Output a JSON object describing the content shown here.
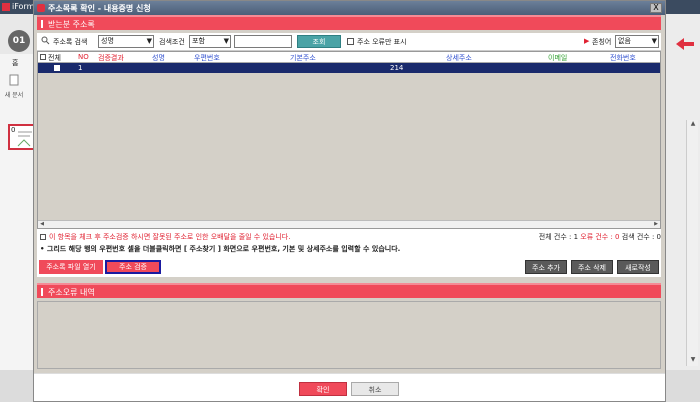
{
  "background": {
    "app_title": "iForm",
    "step_number": "01",
    "left_tab": "홈",
    "left_icon_label": "새 문서",
    "thumb_label": "0"
  },
  "dialog": {
    "title": "주소목록 확인 - 내용증명 신청",
    "close_label": "X"
  },
  "section_recipients": {
    "title": "받는분 주소록"
  },
  "toolbar": {
    "search_label": "주소록 검색",
    "search_field_value": "성명",
    "condition_label": "검색조건",
    "condition_value": "포함",
    "search_input_value": "",
    "search_button": "조회",
    "error_only_label": "주소 오류만 표시",
    "honorific_label": "존칭어",
    "honorific_value": "없음"
  },
  "grid": {
    "headers": {
      "select_all": "전체",
      "no": "NO",
      "verify_result": "검증결과",
      "name": "성명",
      "postal_code": "우편번호",
      "base_address": "기본주소",
      "detail_address": "상세주소",
      "email": "이메일",
      "phone": "전화번호"
    },
    "rows": [
      {
        "no": "1",
        "verify_result": "",
        "name": "",
        "postal_code": "",
        "base_address": "",
        "detail_address": "214",
        "email": "",
        "phone": ""
      }
    ]
  },
  "notes": {
    "warning": "이 항목을 체크 후 주소검증 하시면 잘못된 주소로 인한 오배달을 줄일 수 있습니다.",
    "hint": "• 그리드 해당 행의 우편번호 셀을 더블클릭하면 [ 주소찾기 ] 화면으로 우편번호, 기본 및 상세주소를 입력할 수 있습니다.",
    "total_label": "전체 건수 : 1",
    "error_label": "오류 건수 : 0",
    "search_count_label": "검색 건수 : 0"
  },
  "buttons": {
    "open_file": "주소록 파일 열기",
    "verify": "주소 검증",
    "add": "주소 추가",
    "delete": "주소 삭제",
    "new": "새로작성"
  },
  "section_errors": {
    "title": "주소오류 내역"
  },
  "footer": {
    "ok": "확인",
    "cancel": "취소"
  },
  "colors": {
    "accent": "#f04a5a",
    "selected_row": "#1a2a6c",
    "teal_button": "#4aa3a6",
    "highlight_border": "#1a1aa0"
  }
}
